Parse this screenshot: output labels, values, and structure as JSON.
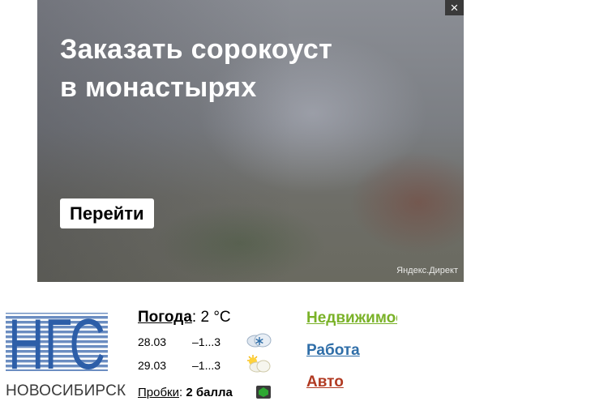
{
  "ad": {
    "title_line1": "Заказать сорокоуст",
    "title_line2": "в монастырях",
    "button_label": "Перейти",
    "source_label": "Яндекс.Директ",
    "close_label": "×"
  },
  "logo": {
    "text": "НГС",
    "city": "НОВОСИБИРСК",
    "color": "#2d5ea8"
  },
  "weather": {
    "link_label": "Погода",
    "current": ": 2 °C",
    "forecast": [
      {
        "date": "28.03",
        "temp": "–1...3",
        "icon": "snow-cloud-icon"
      },
      {
        "date": "29.03",
        "temp": "–1...3",
        "icon": "sun-cloud-icon"
      }
    ]
  },
  "traffic": {
    "link_label": "Пробки",
    "separator": ":",
    "value": "2 балла",
    "status_color": "#2ea832"
  },
  "categories": [
    {
      "label": "Недвижимость",
      "color": "#7ab228"
    },
    {
      "label": "Работа",
      "color": "#2f6ea8"
    },
    {
      "label": "Авто",
      "color": "#b13a22"
    }
  ]
}
